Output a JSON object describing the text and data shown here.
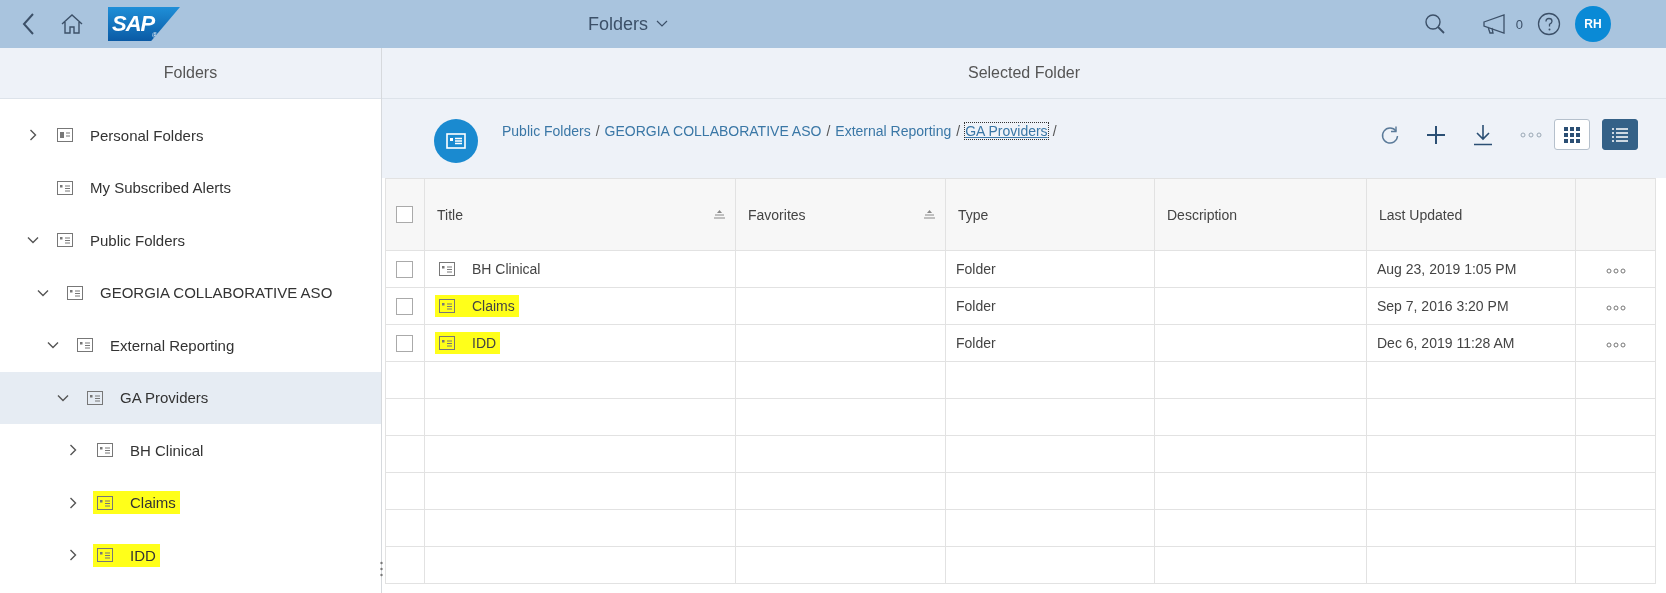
{
  "header": {
    "logo_text": "SAP",
    "logo_mark": "®",
    "title": "Folders",
    "notification_count": "0",
    "avatar_initials": "RH"
  },
  "sidebar": {
    "title": "Folders",
    "tree": [
      {
        "label": "Personal Folders",
        "kind": "personal",
        "expanded": false,
        "selected": false,
        "highlighted": false
      },
      {
        "label": "My Subscribed Alerts",
        "kind": "folder",
        "selected": false,
        "highlighted": false
      },
      {
        "label": "Public Folders",
        "kind": "folder",
        "expanded": true,
        "selected": false,
        "highlighted": false,
        "children": [
          {
            "label": "GEORGIA COLLABORATIVE ASO",
            "kind": "folder",
            "expanded": true,
            "selected": false,
            "highlighted": false,
            "children": [
              {
                "label": "External Reporting",
                "kind": "folder",
                "expanded": true,
                "selected": false,
                "highlighted": false,
                "children": [
                  {
                    "label": "GA Providers",
                    "kind": "folder",
                    "expanded": true,
                    "selected": true,
                    "highlighted": false,
                    "children": [
                      {
                        "label": "BH Clinical",
                        "kind": "folder",
                        "expanded": false,
                        "selected": false,
                        "highlighted": false
                      },
                      {
                        "label": "Claims",
                        "kind": "folder",
                        "expanded": false,
                        "selected": false,
                        "highlighted": true
                      },
                      {
                        "label": "IDD",
                        "kind": "folder",
                        "expanded": false,
                        "selected": false,
                        "highlighted": true
                      }
                    ]
                  }
                ]
              }
            ]
          }
        ]
      }
    ]
  },
  "content": {
    "title": "Selected Folder",
    "breadcrumb": {
      "separator": "/",
      "items": [
        {
          "label": "Public Folders",
          "focused": false
        },
        {
          "label": "GEORGIA COLLABORATIVE ASO",
          "focused": false
        },
        {
          "label": "External Reporting",
          "focused": false
        },
        {
          "label": "GA Providers",
          "focused": true
        }
      ]
    },
    "view_toggle": [
      {
        "kind": "grid",
        "selected": false
      },
      {
        "kind": "list",
        "selected": true
      }
    ],
    "table": {
      "all_checked": false,
      "columns": [
        {
          "label": "Title",
          "sortable": true
        },
        {
          "label": "Favorites",
          "sortable": true
        },
        {
          "label": "Type",
          "sortable": false
        },
        {
          "label": "Description",
          "sortable": false
        },
        {
          "label": "Last Updated",
          "sortable": false
        }
      ],
      "rows": [
        {
          "title": "BH Clinical",
          "checked": false,
          "highlighted": false,
          "type": "Folder",
          "last_updated": "Aug 23, 2019 1:05 PM"
        },
        {
          "title": "Claims",
          "checked": false,
          "highlighted": true,
          "type": "Folder",
          "last_updated": "Sep 7, 2016 3:20 PM"
        },
        {
          "title": "IDD",
          "checked": false,
          "highlighted": true,
          "type": "Folder",
          "last_updated": "Dec 6, 2019 11:28 AM"
        }
      ]
    }
  }
}
